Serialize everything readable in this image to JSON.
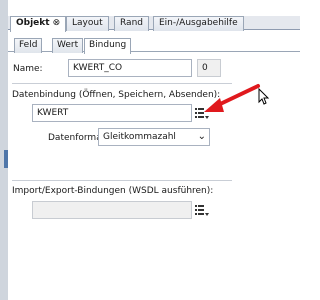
{
  "tabs": [
    {
      "label": "Objekt",
      "close": "⊗",
      "active": true
    },
    {
      "label": "Layout"
    },
    {
      "label": "Rand"
    },
    {
      "label": "Ein-/Ausgabehilfe"
    }
  ],
  "subtabs": [
    {
      "label": "Feld"
    },
    {
      "label": "Wert"
    },
    {
      "label": "Bindung",
      "active": true
    }
  ],
  "name": {
    "label": "Name:",
    "value": "KWERT_CO",
    "index": "0"
  },
  "binding": {
    "label": "Datenbindung (Öffnen, Speichern, Absenden):",
    "value": "KWERT",
    "format_label": "Datenformat:",
    "format_value": "Gleitkommazahl"
  },
  "import_export": {
    "label": "Import/Export-Bindungen (WSDL ausführen):",
    "value": ""
  },
  "icons": {
    "binding_menu": "list-dropdown-icon",
    "cursor": "mouse-pointer-icon",
    "arrow": "red-arrow-annotation"
  },
  "colors": {
    "annotation_arrow": "#e0191d",
    "accent": "#4f76a9"
  }
}
